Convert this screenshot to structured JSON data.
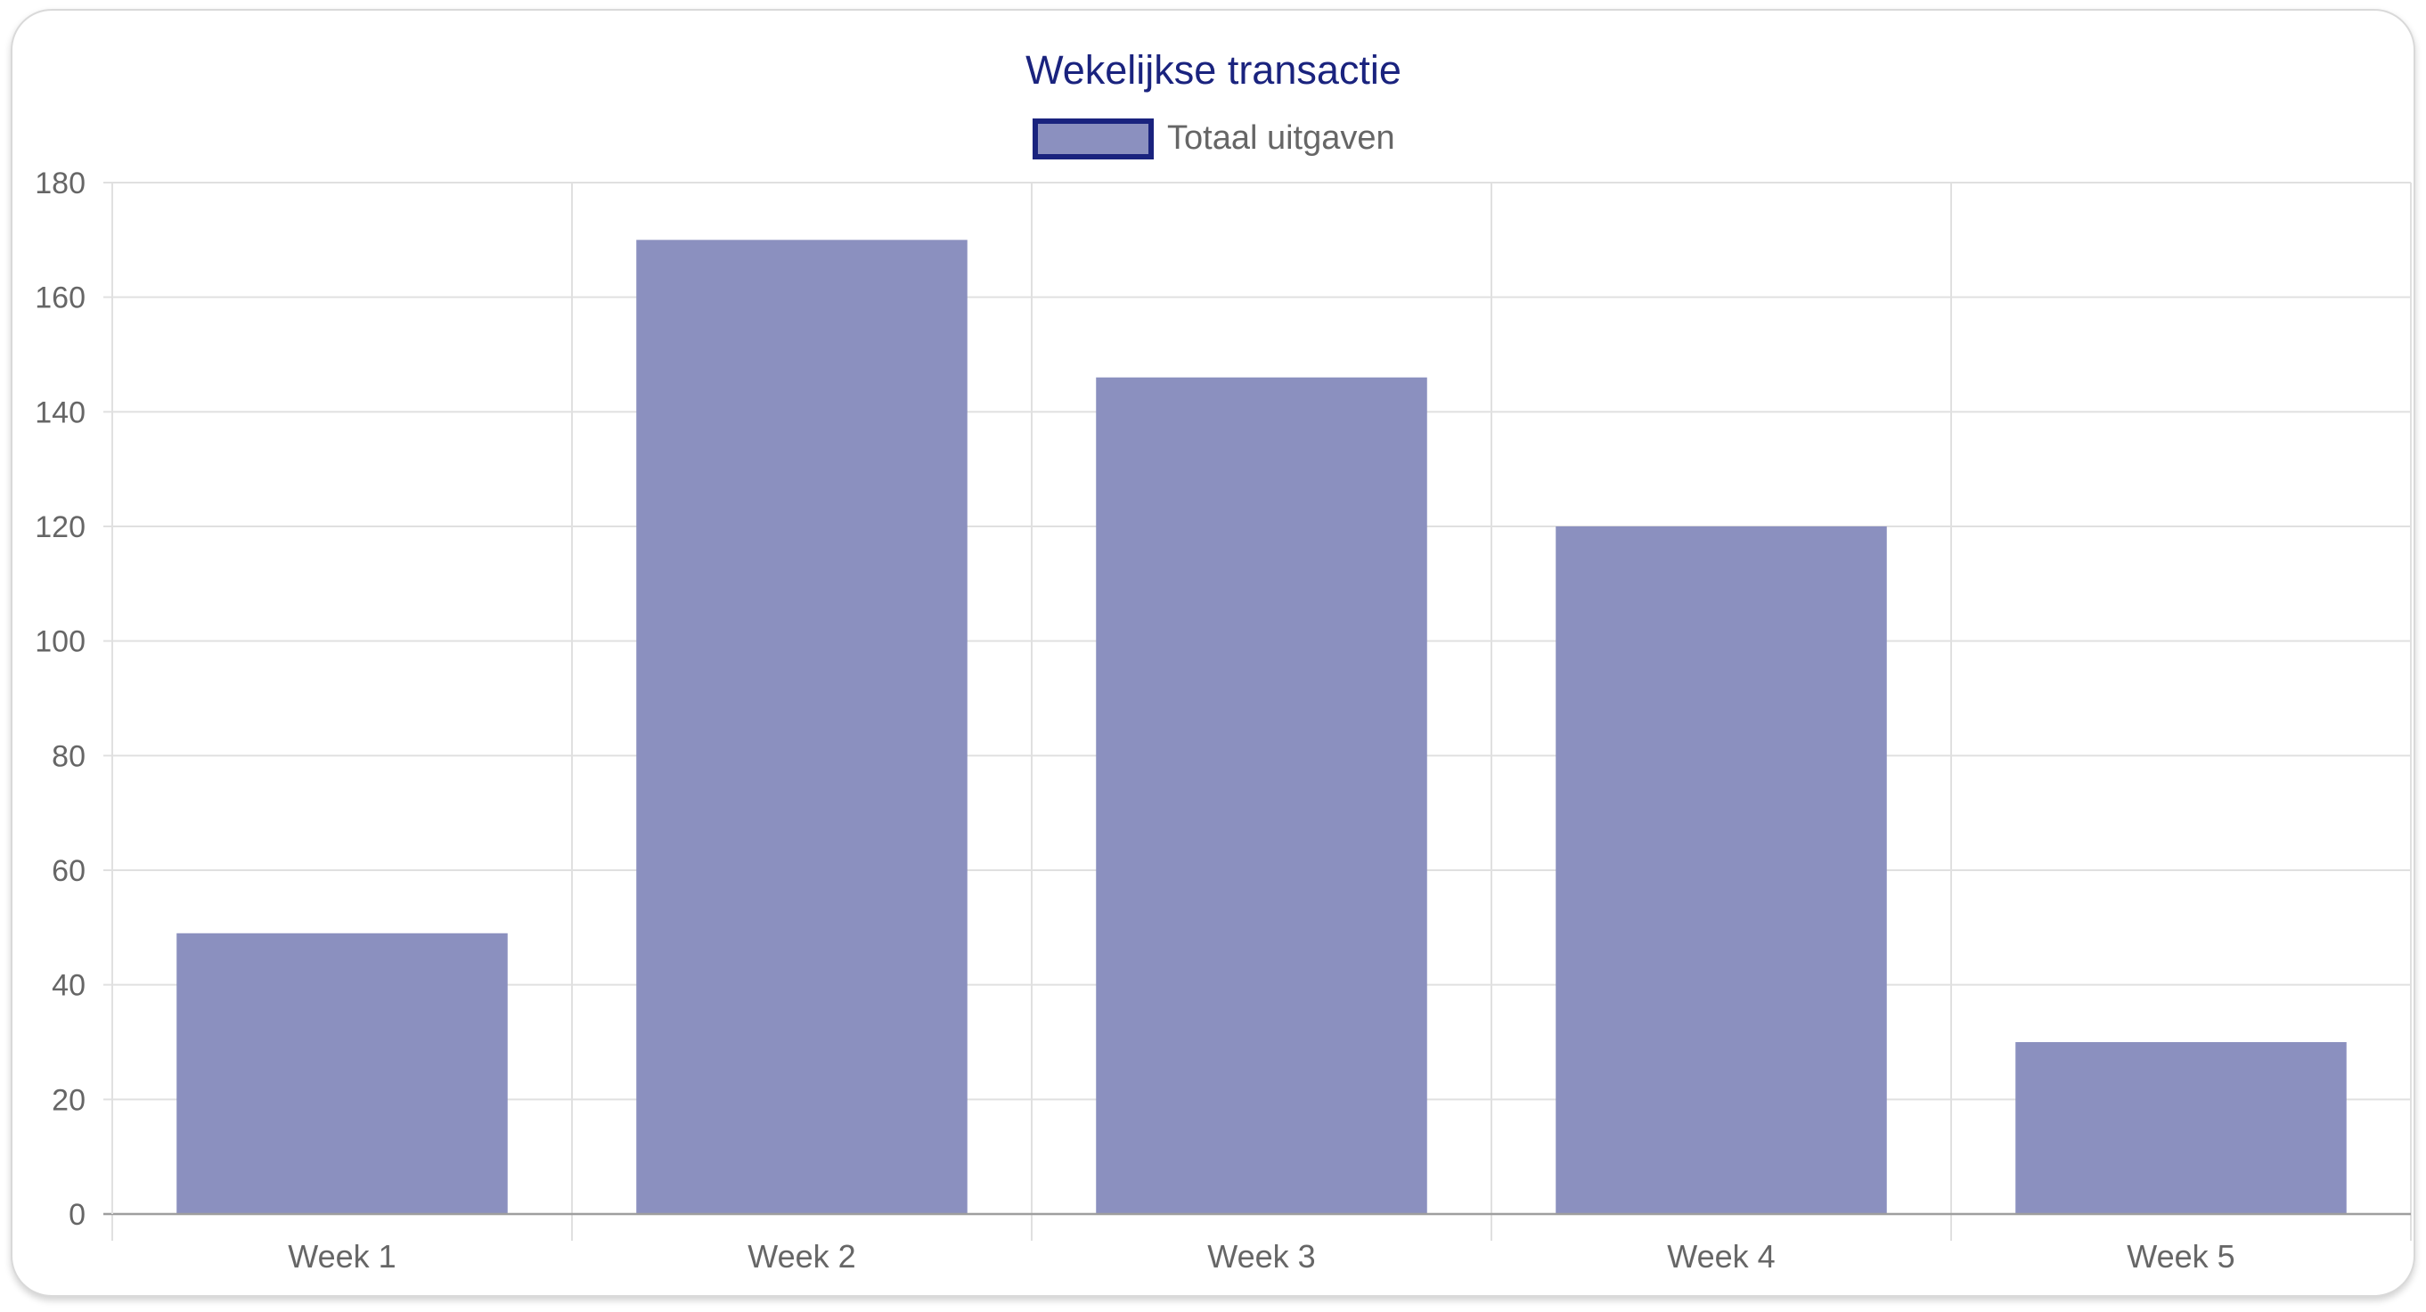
{
  "chart_data": {
    "type": "bar",
    "title": "Wekelijkse transactie",
    "xlabel": "",
    "ylabel": "",
    "categories": [
      "Week 1",
      "Week 2",
      "Week 3",
      "Week 4",
      "Week 5"
    ],
    "series": [
      {
        "name": "Totaal uitgaven",
        "values": [
          49,
          170,
          146,
          120,
          30
        ],
        "fill_color": "#8b90bf",
        "border_color": "#1a237e"
      }
    ],
    "ylim": [
      0,
      180
    ],
    "yticks": [
      "0",
      "20",
      "40",
      "60",
      "80",
      "100",
      "120",
      "140",
      "160",
      "180"
    ],
    "grid": true,
    "legend_position": "top-center"
  },
  "colors": {
    "title": "#1a237e",
    "grid": "#e0e0e0",
    "axis": "#9e9e9e",
    "text": "#666666"
  }
}
